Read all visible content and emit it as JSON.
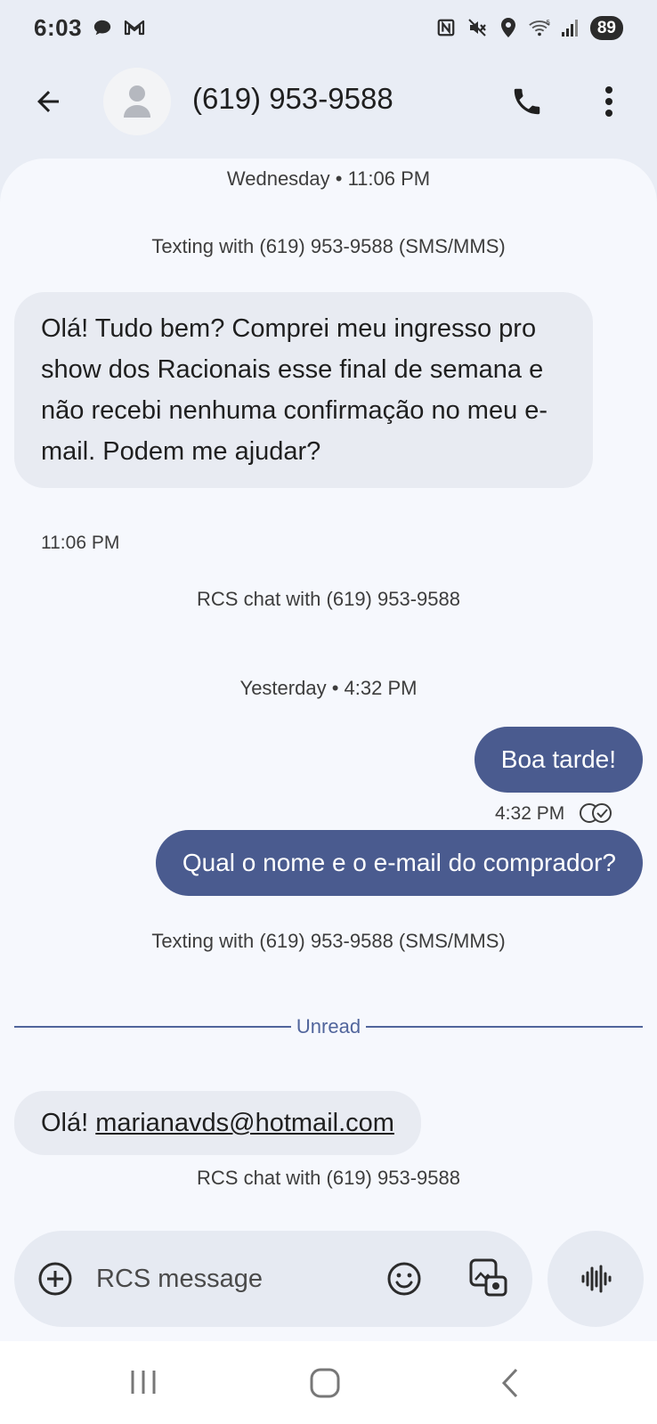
{
  "status_bar": {
    "time": "6:03",
    "battery": "89",
    "icons": [
      "chat-bubble-icon",
      "gmail-icon",
      "nfc-icon",
      "mute-icon",
      "location-icon",
      "wifi-icon",
      "signal-icon"
    ]
  },
  "header": {
    "contact": "(619) 953-9588",
    "icons": [
      "back-arrow-icon",
      "avatar-person-icon",
      "phone-icon",
      "more-vert-icon"
    ]
  },
  "conversation": {
    "notes": {
      "date_1": "Wednesday • 11:06 PM",
      "texting_1": "Texting with (619) 953-9588 (SMS/MMS)",
      "rcs_1": "RCS chat with (619) 953-9588",
      "date_2": "Yesterday • 4:32 PM",
      "texting_2": "Texting with (619) 953-9588 (SMS/MMS)",
      "rcs_2": "RCS chat with (619) 953-9588"
    },
    "messages": [
      {
        "direction": "incoming",
        "text": "Olá! Tudo bem? Comprei meu ingresso pro show dos Racionais esse final de semana e não recebi nenhuma confirmação no meu e-mail. Podem me ajudar?",
        "time": "11:06 PM"
      },
      {
        "direction": "outgoing",
        "text": "Boa tarde!",
        "time": "4:32 PM",
        "status_icon": "delivered-check-icon"
      },
      {
        "direction": "outgoing",
        "text": "Qual o nome e o e-mail do comprador?"
      },
      {
        "direction": "incoming",
        "prefix": "Olá!",
        "link": "marianavds@hotmail.com"
      }
    ],
    "unread_label": "Unread"
  },
  "composer": {
    "placeholder": "RCS message",
    "icons": [
      "add-circle-icon",
      "emoji-icon",
      "gallery-icon",
      "voice-waveform-icon"
    ]
  },
  "colors": {
    "outgoing_bubble": "#4a5b8f",
    "incoming_bubble": "#e8ebf2",
    "accent": "#51659c",
    "background": "#e9edf5"
  }
}
